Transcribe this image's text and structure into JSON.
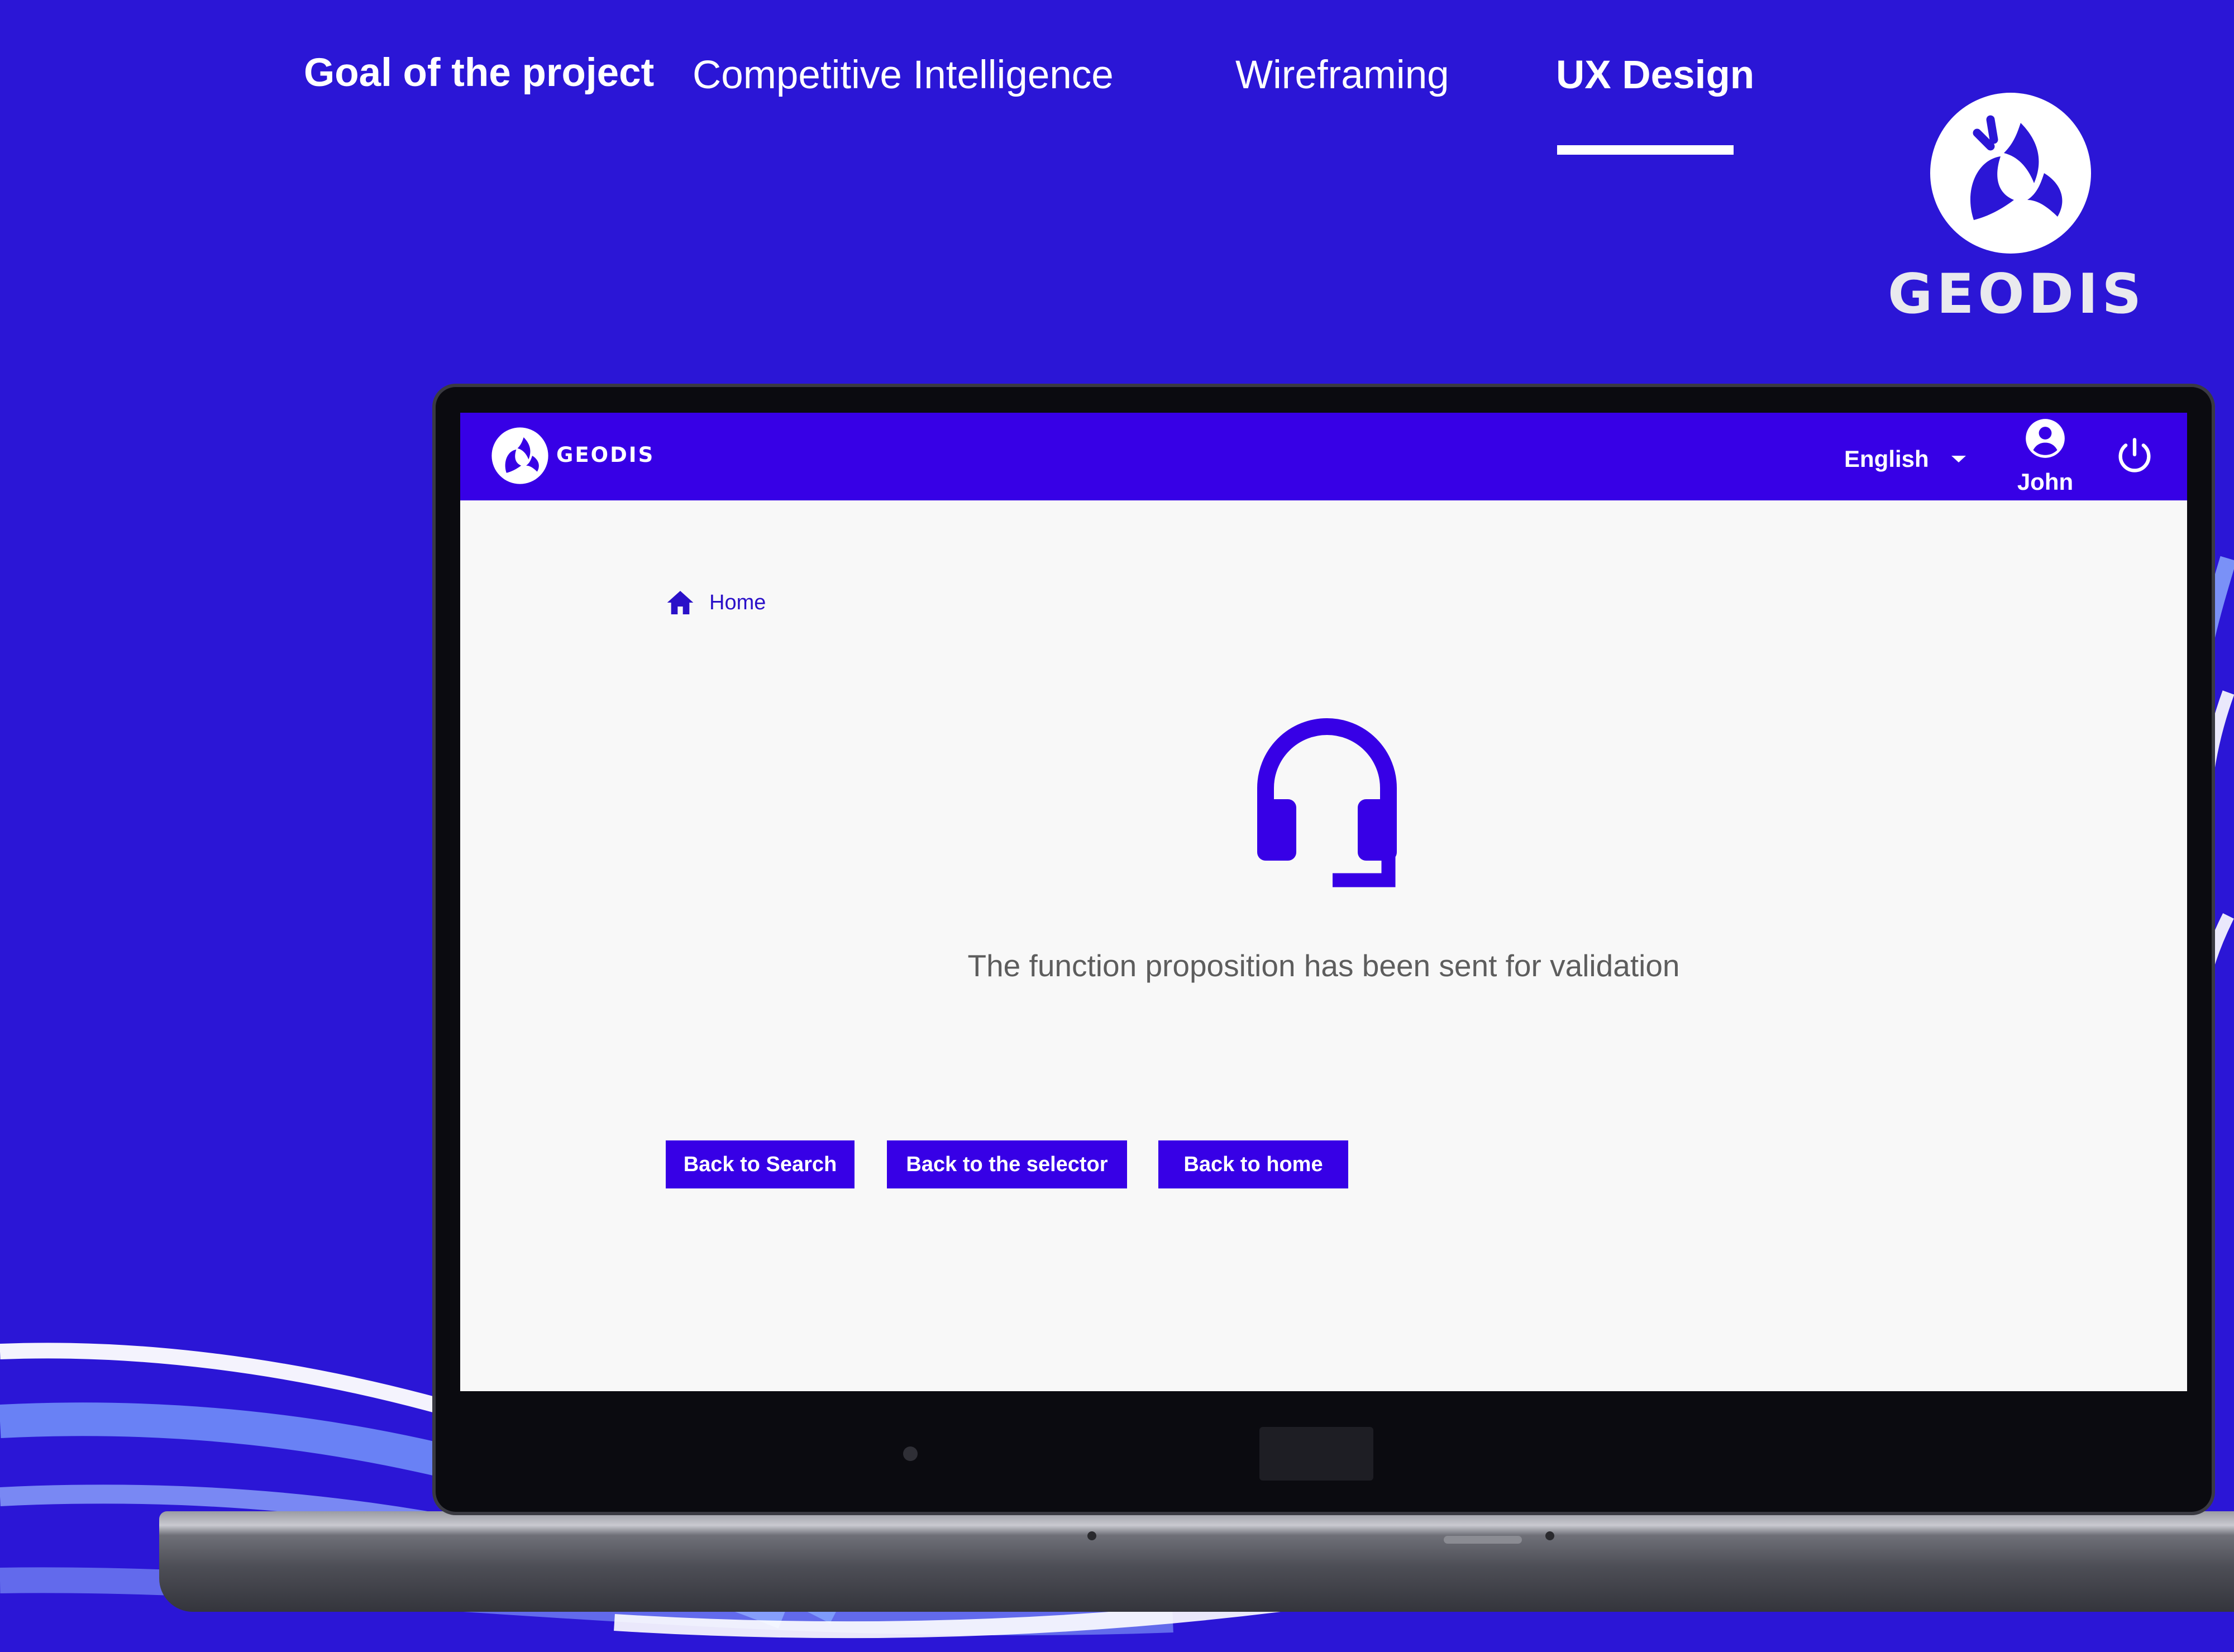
{
  "nav": {
    "items": [
      {
        "label": "Goal of the project"
      },
      {
        "label": "Competitive Intelligence"
      },
      {
        "label": "Wireframing"
      },
      {
        "label": "UX Design"
      }
    ],
    "active_index": 3
  },
  "brand": {
    "name": "GEODIS"
  },
  "app": {
    "logo_text": "GEODIS",
    "language": {
      "selected": "English"
    },
    "user": {
      "name": "John"
    }
  },
  "breadcrumb": {
    "home_label": "Home"
  },
  "confirmation": {
    "message": "The function proposition has been sent for validation"
  },
  "actions": {
    "back_to_search": "Back to Search",
    "back_to_selector": "Back to the selector",
    "back_to_home": "Back to home"
  },
  "colors": {
    "background": "#2b16d6",
    "app_primary": "#3700e6",
    "screen_background": "#f8f8f8",
    "message_text": "#5d5d5d"
  },
  "icons": {
    "brand": "geodis-logo-icon",
    "headset": "headset-icon",
    "home": "home-icon",
    "user": "account-circle-icon",
    "power": "power-icon",
    "dropdown": "chevron-down-icon"
  }
}
